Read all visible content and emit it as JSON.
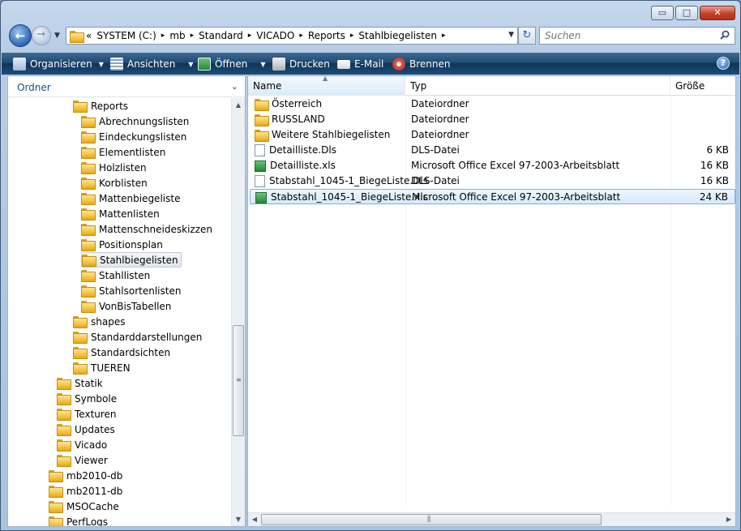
{
  "window": {
    "minimize_glyph": "▭",
    "maximize_glyph": "□",
    "close_glyph": "✕"
  },
  "nav": {
    "back_glyph": "←",
    "forward_glyph": "→",
    "history_glyph": "▼"
  },
  "address": {
    "prefix": "«",
    "crumbs": [
      "SYSTEM (C:)",
      "mb",
      "Standard",
      "VICADO",
      "Reports",
      "Stahlbiegelisten"
    ],
    "separator": "▸",
    "dropdown_glyph": "▼",
    "refresh_glyph": "↻"
  },
  "search": {
    "placeholder": "Suchen"
  },
  "toolbar": {
    "organize": "Organisieren",
    "views": "Ansichten",
    "open": "Öffnen",
    "print": "Drucken",
    "email": "E-Mail",
    "burn": "Brennen",
    "dd_glyph": "▼",
    "help_glyph": "?"
  },
  "navpane": {
    "header": "Ordner",
    "chevron": "⌄",
    "scroll_up": "▲",
    "scroll_down": "▼",
    "grip": "≡",
    "items": [
      {
        "label": "Reports",
        "level": 2,
        "selected": false
      },
      {
        "label": "Abrechnungslisten",
        "level": 3,
        "selected": false
      },
      {
        "label": "Eindeckungslisten",
        "level": 3,
        "selected": false
      },
      {
        "label": "Elementlisten",
        "level": 3,
        "selected": false
      },
      {
        "label": "Holzlisten",
        "level": 3,
        "selected": false
      },
      {
        "label": "Korblisten",
        "level": 3,
        "selected": false
      },
      {
        "label": "Mattenbiegeliste",
        "level": 3,
        "selected": false
      },
      {
        "label": "Mattenlisten",
        "level": 3,
        "selected": false
      },
      {
        "label": "Mattenschneideskizzen",
        "level": 3,
        "selected": false
      },
      {
        "label": "Positionsplan",
        "level": 3,
        "selected": false
      },
      {
        "label": "Stahlbiegelisten",
        "level": 3,
        "selected": true
      },
      {
        "label": "Stahllisten",
        "level": 3,
        "selected": false
      },
      {
        "label": "Stahlsortenlisten",
        "level": 3,
        "selected": false
      },
      {
        "label": "VonBisTabellen",
        "level": 3,
        "selected": false
      },
      {
        "label": "shapes",
        "level": 2,
        "selected": false
      },
      {
        "label": "Standarddarstellungen",
        "level": 2,
        "selected": false
      },
      {
        "label": "Standardsichten",
        "level": 2,
        "selected": false
      },
      {
        "label": "TUEREN",
        "level": 2,
        "selected": false
      },
      {
        "label": "Statik",
        "level": 1,
        "selected": false
      },
      {
        "label": "Symbole",
        "level": 1,
        "selected": false
      },
      {
        "label": "Texturen",
        "level": 1,
        "selected": false
      },
      {
        "label": "Updates",
        "level": 1,
        "selected": false
      },
      {
        "label": "Vicado",
        "level": 1,
        "selected": false
      },
      {
        "label": "Viewer",
        "level": 1,
        "selected": false
      },
      {
        "label": "mb2010-db",
        "level": 0,
        "selected": false
      },
      {
        "label": "mb2011-db",
        "level": 0,
        "selected": false
      },
      {
        "label": "MSOCache",
        "level": 0,
        "selected": false
      },
      {
        "label": "PerfLogs",
        "level": 0,
        "selected": false
      }
    ]
  },
  "filelist": {
    "columns": {
      "name": "Name",
      "type": "Typ",
      "size": "Größe"
    },
    "sort_glyph": "▲",
    "scroll_left": "◀",
    "scroll_right": "▶",
    "grip": "⫼",
    "rows": [
      {
        "name": "Österreich",
        "type": "Dateiordner",
        "size": "",
        "icon": "folder",
        "selected": false
      },
      {
        "name": "RUSSLAND",
        "type": "Dateiordner",
        "size": "",
        "icon": "folder",
        "selected": false
      },
      {
        "name": "Weitere Stahlbiegelisten",
        "type": "Dateiordner",
        "size": "",
        "icon": "folder",
        "selected": false
      },
      {
        "name": "Detailliste.Dls",
        "type": "DLS-Datei",
        "size": "6 KB",
        "icon": "document",
        "selected": false
      },
      {
        "name": "Detailliste.xls",
        "type": "Microsoft Office Excel 97-2003-Arbeitsblatt",
        "size": "16 KB",
        "icon": "excel",
        "selected": false
      },
      {
        "name": "Stabstahl_1045-1_BiegeListe.Dls",
        "type": "DLS-Datei",
        "size": "16 KB",
        "icon": "document",
        "selected": false
      },
      {
        "name": "Stabstahl_1045-1_BiegeListe.xls",
        "type": "Microsoft Office Excel 97-2003-Arbeitsblatt",
        "size": "24 KB",
        "icon": "excel",
        "selected": true
      }
    ]
  },
  "colors": {
    "selection_border": "#84acdd",
    "toolbar_dark": "#0f3558",
    "folder_yellow": "#f3c441"
  }
}
